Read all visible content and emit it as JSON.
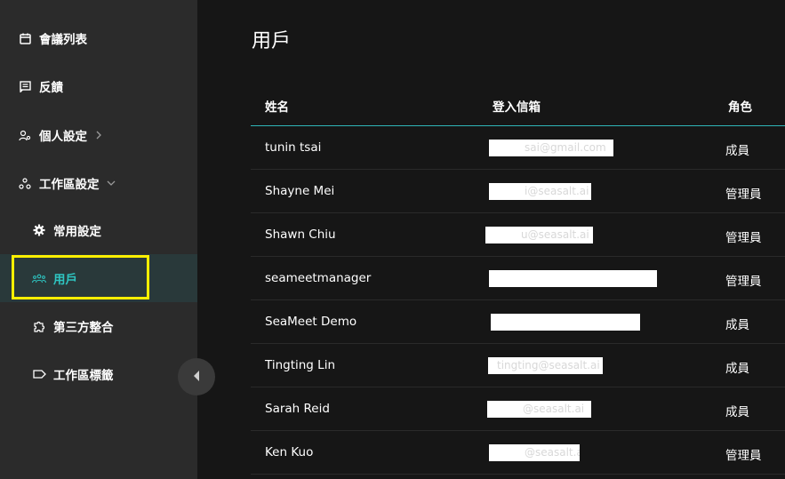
{
  "sidebar": {
    "items": [
      {
        "label": "會議列表",
        "icon": "calendar-icon"
      },
      {
        "label": "反饋",
        "icon": "feedback-icon"
      },
      {
        "label": "個人設定",
        "icon": "person-settings-icon"
      },
      {
        "label": "工作區設定",
        "icon": "workspace-icon"
      },
      {
        "label": "常用設定",
        "icon": "gear-icon"
      },
      {
        "label": "用戶",
        "icon": "users-icon",
        "active": true
      },
      {
        "label": "第三方整合",
        "icon": "puzzle-icon"
      },
      {
        "label": "工作區標籤",
        "icon": "tag-icon"
      }
    ]
  },
  "main": {
    "title": "用戶",
    "table": {
      "columns": [
        "姓名",
        "登入信箱",
        "角色"
      ],
      "rows": [
        {
          "name": "tunin tsai",
          "email": "sai@gmail.com",
          "role": "成員"
        },
        {
          "name": "Shayne Mei",
          "email": "i@seasalt.ai",
          "role": "管理員"
        },
        {
          "name": "Shawn Chiu",
          "email": "u@seasalt.ai",
          "role": "管理員"
        },
        {
          "name": "seameetmanager",
          "email": "",
          "role": "管理員"
        },
        {
          "name": "SeaMeet Demo",
          "email": "",
          "role": "成員"
        },
        {
          "name": "Tingting Lin",
          "email": "tingting@seasalt.ai",
          "role": "成員"
        },
        {
          "name": "Sarah Reid",
          "email": "@seasalt.ai",
          "role": "成員"
        },
        {
          "name": "Ken Kuo",
          "email": "@seasalt.ai",
          "role": "管理員"
        }
      ]
    }
  },
  "colors": {
    "accent": "#2ec5c1",
    "highlight": "#ffef00",
    "sidebar_bg": "#2b2b2b",
    "main_bg": "#161616"
  }
}
